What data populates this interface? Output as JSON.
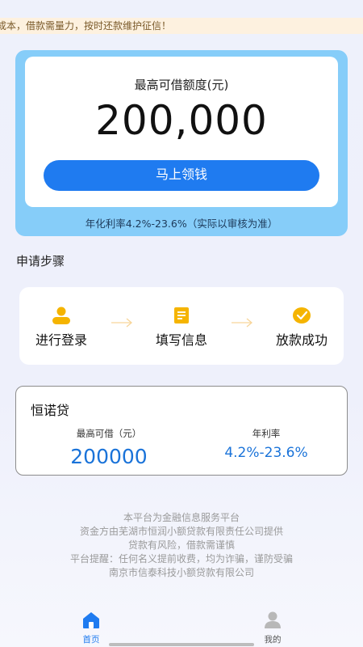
{
  "notice": {
    "text": "成本，借款需量力，按时还款维护征信！"
  },
  "quota": {
    "label": "最高可借额度(元)",
    "amount": "200,000",
    "cta_label": "马上领钱",
    "rate_note": "年化利率4.2%-23.6%（实际以审核为准）"
  },
  "steps": {
    "title": "申请步骤",
    "items": [
      {
        "label": "进行登录",
        "icon": "user-icon"
      },
      {
        "label": "填写信息",
        "icon": "document-icon"
      },
      {
        "label": "放款成功",
        "icon": "check-circle-icon"
      }
    ]
  },
  "product": {
    "name": "恒诺贷",
    "max_label": "最高可借（元）",
    "max_value": "200000",
    "rate_label": "年利率",
    "rate_value": "4.2%-23.6%"
  },
  "footer": {
    "lines": [
      "本平台为金融信息服务平台",
      "资金方由芜湖市恒润小额贷款有限责任公司提供",
      "贷款有风险，借款需谨慎",
      "平台提醒：任何名义提前收费，均为诈骗，谨防受骗",
      "南京市信泰科技小额贷款有限公司"
    ]
  },
  "tabbar": {
    "home_label": "首页",
    "mine_label": "我的"
  },
  "colors": {
    "accent": "#1f7bf0",
    "panel": "#86cdf9",
    "icon_yellow": "#f5b400",
    "value_blue": "#1a73d9"
  }
}
